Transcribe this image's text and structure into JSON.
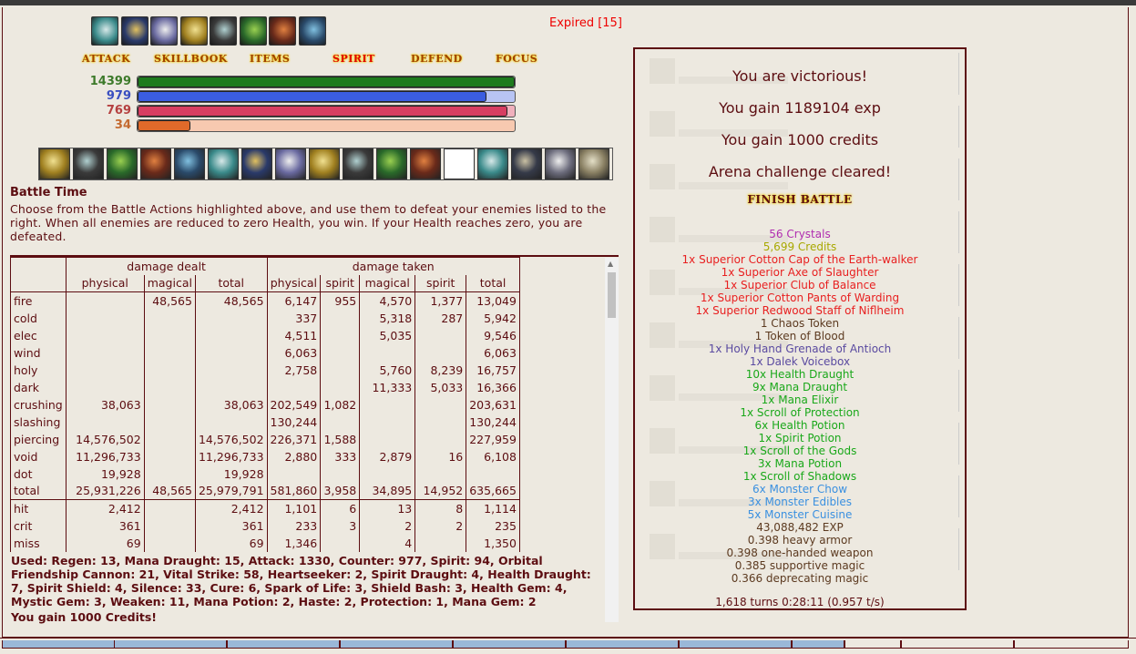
{
  "expired": "Expired [15]",
  "buff_icons": [
    "regen-icon",
    "spark-icon",
    "protection-icon",
    "haste-icon",
    "shadow-veil-icon",
    "spirit-shield-icon",
    "heartseeker-icon",
    "absorb-icon"
  ],
  "menu": [
    "ATTACK",
    "SKILLBOOK",
    "ITEMS",
    "SPIRIT",
    "DEFEND",
    "FOCUS"
  ],
  "active_menu": "SPIRIT",
  "bars": [
    {
      "label": "14399",
      "color": "#1e7b1e",
      "light": "#8fd18f",
      "fraction": 1.0,
      "numcolor": "#3d7a2a"
    },
    {
      "label": "979",
      "color": "#3b5de0",
      "light": "#b8c4f4",
      "fraction": 0.925,
      "numcolor": "#3a4fc0"
    },
    {
      "label": "769",
      "color": "#d73e62",
      "light": "#f0b0bc",
      "fraction": 0.98,
      "numcolor": "#b54040"
    },
    {
      "label": "34",
      "color": "#e06a2a",
      "light": "#f7c9b0",
      "fraction": 0.14,
      "numcolor": "#c46a30"
    }
  ],
  "skill_icons": [
    "skill-1-icon",
    "skill-2-icon",
    "skill-3-icon",
    "skill-4-icon",
    "skill-5-icon",
    "skill-6-icon",
    "skill-7-icon",
    "skill-8-icon",
    "skill-9-icon",
    "skill-10-icon",
    "skill-11-icon",
    "skill-12-icon",
    "skill-empty-icon",
    "skill-14-icon",
    "skill-15-icon",
    "skill-16-icon",
    "skill-17-icon"
  ],
  "battle_title": "Battle Time",
  "battle_desc": "Choose from the Battle Actions highlighted above, and use them to defeat your enemies listed to the right. When all enemies are reduced to zero Health, you win. If your Health reaches zero, you are defeated.",
  "table": {
    "group_headers": [
      "damage dealt",
      "damage taken"
    ],
    "col_headers": [
      "physical",
      "magical",
      "total",
      "physical",
      "spirit",
      "magical",
      "spirit",
      "total"
    ],
    "rows": [
      [
        "fire",
        "",
        "48,565",
        "48,565",
        "6,147",
        "955",
        "4,570",
        "1,377",
        "13,049"
      ],
      [
        "cold",
        "",
        "",
        "",
        "337",
        "",
        "5,318",
        "287",
        "5,942"
      ],
      [
        "elec",
        "",
        "",
        "",
        "4,511",
        "",
        "5,035",
        "",
        "9,546"
      ],
      [
        "wind",
        "",
        "",
        "",
        "6,063",
        "",
        "",
        "",
        "6,063"
      ],
      [
        "holy",
        "",
        "",
        "",
        "2,758",
        "",
        "5,760",
        "8,239",
        "16,757"
      ],
      [
        "dark",
        "",
        "",
        "",
        "",
        "",
        "11,333",
        "5,033",
        "16,366"
      ],
      [
        "crushing",
        "38,063",
        "",
        "38,063",
        "202,549",
        "1,082",
        "",
        "",
        "203,631"
      ],
      [
        "slashing",
        "",
        "",
        "",
        "130,244",
        "",
        "",
        "",
        "130,244"
      ],
      [
        "piercing",
        "14,576,502",
        "",
        "14,576,502",
        "226,371",
        "1,588",
        "",
        "",
        "227,959"
      ],
      [
        "void",
        "11,296,733",
        "",
        "11,296,733",
        "2,880",
        "333",
        "2,879",
        "16",
        "6,108"
      ],
      [
        "dot",
        "19,928",
        "",
        "19,928",
        "",
        "",
        "",
        "",
        ""
      ],
      [
        "total",
        "25,931,226",
        "48,565",
        "25,979,791",
        "581,860",
        "3,958",
        "34,895",
        "14,952",
        "635,665"
      ],
      [
        "hit",
        "2,412",
        "",
        "2,412",
        "1,101",
        "6",
        "13",
        "8",
        "1,114"
      ],
      [
        "crit",
        "361",
        "",
        "361",
        "233",
        "3",
        "2",
        "2",
        "235"
      ],
      [
        "miss",
        "69",
        "",
        "69",
        "1,346",
        "",
        "4",
        "",
        "1,350"
      ]
    ]
  },
  "used": "Used: Regen: 13, Mana Draught: 15, Attack: 1330, Counter: 977, Spirit: 94, Orbital Friendship Cannon: 21, Vital Strike: 58, Heartseeker: 2, Spirit Draught: 4, Health Draught: 7, Spirit Shield: 4, Silence: 33, Cure: 6, Spark of Life: 3, Shield Bash: 3, Health Gem: 4, Mystic Gem: 3, Weaken: 11, Mana Potion: 2, Haste: 2, Protection: 1, Mana Gem: 2",
  "gain_credits": "You gain 1000 Credits!",
  "panel": {
    "messages": [
      "You are victorious!",
      "You gain 1189104 exp",
      "You gain 1000 credits",
      "Arena challenge cleared!"
    ],
    "finish_button": "FINISH BATTLE",
    "drops": [
      {
        "text": "56 Crystals",
        "color": "#b02db0"
      },
      {
        "text": "5,699 Credits",
        "color": "#a8a800"
      },
      {
        "text": "1x Superior Cotton Cap of the Earth-walker",
        "color": "#e82020"
      },
      {
        "text": "1x Superior Axe of Slaughter",
        "color": "#e82020"
      },
      {
        "text": "1x Superior Club of Balance",
        "color": "#e82020"
      },
      {
        "text": "1x Superior Cotton Pants of Warding",
        "color": "#e82020"
      },
      {
        "text": "1x Superior Redwood Staff of Niflheim",
        "color": "#e82020"
      },
      {
        "text": "1 Chaos Token",
        "color": "#5c3a20"
      },
      {
        "text": "1 Token of Blood",
        "color": "#5c3a20"
      },
      {
        "text": "1x Holy Hand Grenade of Antioch",
        "color": "#5a4aa0"
      },
      {
        "text": "1x Dalek Voicebox",
        "color": "#5a4aa0"
      },
      {
        "text": "10x Health Draught",
        "color": "#1aa81a"
      },
      {
        "text": "9x Mana Draught",
        "color": "#1aa81a"
      },
      {
        "text": "1x Mana Elixir",
        "color": "#1aa81a"
      },
      {
        "text": "1x Scroll of Protection",
        "color": "#1aa81a"
      },
      {
        "text": "6x Health Potion",
        "color": "#1aa81a"
      },
      {
        "text": "1x Spirit Potion",
        "color": "#1aa81a"
      },
      {
        "text": "1x Scroll of the Gods",
        "color": "#1aa81a"
      },
      {
        "text": "3x Mana Potion",
        "color": "#1aa81a"
      },
      {
        "text": "1x Scroll of Shadows",
        "color": "#1aa81a"
      },
      {
        "text": "6x Monster Chow",
        "color": "#3a90e0"
      },
      {
        "text": "3x Monster Edibles",
        "color": "#3a90e0"
      },
      {
        "text": "5x Monster Cuisine",
        "color": "#3a90e0"
      },
      {
        "text": "43,088,482 EXP",
        "color": "#5c3a20"
      },
      {
        "text": "0.398 heavy armor",
        "color": "#5c3a20"
      },
      {
        "text": "0.398 one-handed weapon",
        "color": "#5c3a20"
      },
      {
        "text": "0.385 supportive magic",
        "color": "#5c3a20"
      },
      {
        "text": "0.366 deprecating magic",
        "color": "#5c3a20"
      }
    ],
    "turns": "1,618 turns 0:28:11 (0.957 t/s)"
  }
}
